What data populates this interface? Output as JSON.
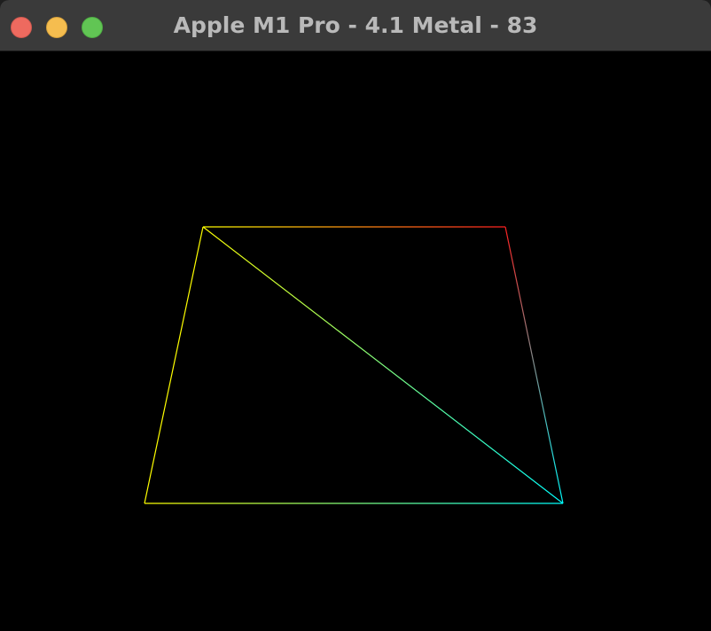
{
  "window": {
    "title": "Apple M1 Pro - 4.1 Metal - 83"
  },
  "controls": {
    "close_icon": "close-icon",
    "minimize_icon": "minimize-icon",
    "zoom_icon": "zoom-icon",
    "colors": {
      "close": "#ee6a5f",
      "minimize": "#f5bd4f",
      "zoom": "#61c554"
    }
  },
  "scene": {
    "background": "#000000",
    "render_mode": "wireframe",
    "vertex_colors": {
      "top_left": "#ffff00",
      "top_right": "#ff0000",
      "bottom_left": "#ffff00",
      "bottom_right": "#00ffff"
    }
  }
}
